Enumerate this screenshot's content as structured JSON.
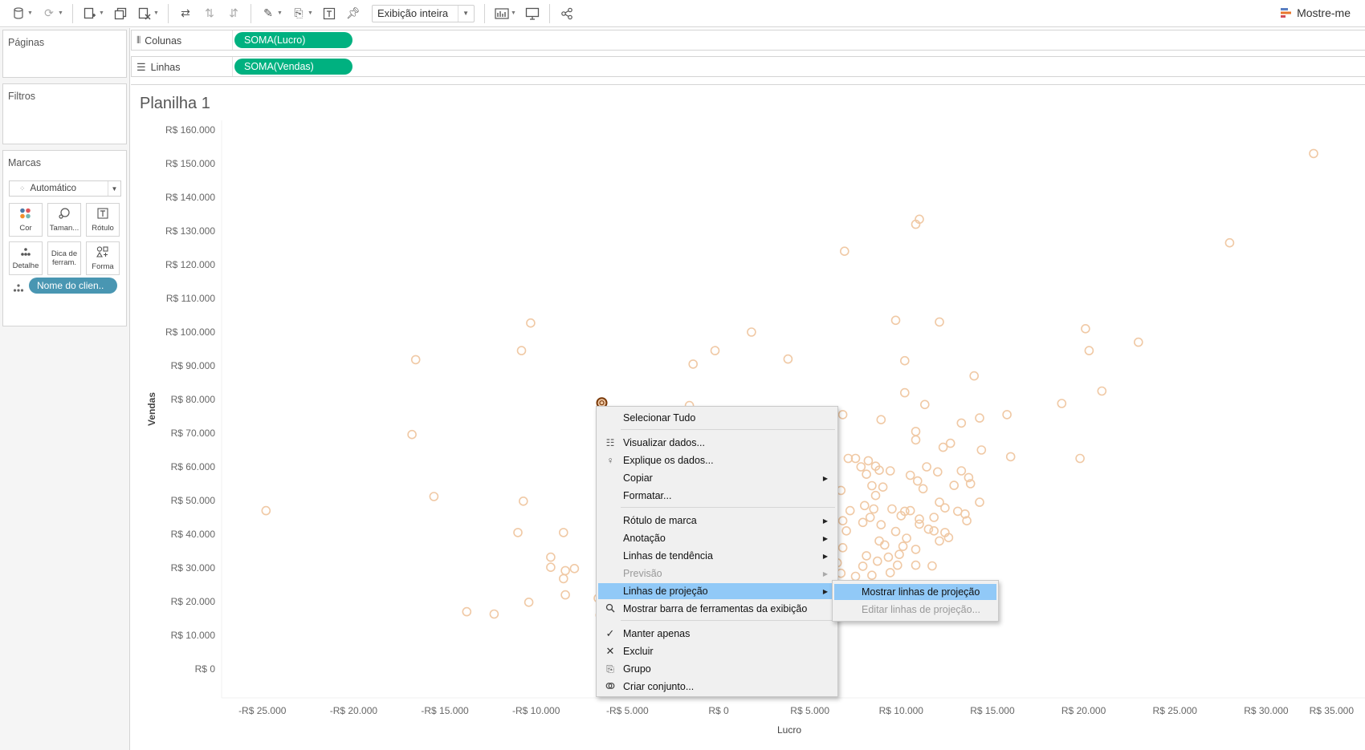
{
  "toolbar": {
    "view_select": "Exibição inteira",
    "show_me": "Mostre-me"
  },
  "panels": {
    "pages": "Páginas",
    "filters": "Filtros",
    "marks": "Marcas",
    "mark_type": "Automático",
    "mark_buttons": [
      "Cor",
      "Taman...",
      "Rótulo",
      "Detalhe",
      "Dica de\nferram.",
      "Forma"
    ],
    "detail_pill": "Nome do clien.."
  },
  "shelves": {
    "columns_label": "Colunas",
    "columns_pill": "SOMA(Lucro)",
    "rows_label": "Linhas",
    "rows_pill": "SOMA(Vendas)"
  },
  "sheet": {
    "title": "Planilha 1"
  },
  "chart_data": {
    "type": "scatter",
    "xlabel": "Lucro",
    "ylabel": "Vendas",
    "xlim": [
      -27000,
      35000
    ],
    "ylim": [
      -8000,
      163000
    ],
    "x_ticks": [
      -25000,
      -20000,
      -15000,
      -10000,
      -5000,
      0,
      5000,
      10000,
      15000,
      20000,
      25000,
      30000,
      35000
    ],
    "x_tick_labels": [
      "-R$ 25.000",
      "-R$ 20.000",
      "-R$ 15.000",
      "-R$ 10.000",
      "-R$ 5.000",
      "R$ 0",
      "R$ 5.000",
      "R$ 10.000",
      "R$ 15.000",
      "R$ 20.000",
      "R$ 25.000",
      "R$ 30.000",
      "R$ 35.000"
    ],
    "y_ticks": [
      0,
      10000,
      20000,
      30000,
      40000,
      50000,
      60000,
      70000,
      80000,
      90000,
      100000,
      110000,
      120000,
      130000,
      140000,
      150000,
      160000
    ],
    "y_tick_labels": [
      "R$ 0",
      "R$ 10.000",
      "R$ 20.000",
      "R$ 30.000",
      "R$ 40.000",
      "R$ 50.000",
      "R$ 60.000",
      "R$ 70.000",
      "R$ 80.000",
      "R$ 90.000",
      "R$ 100.000",
      "R$ 110.000",
      "R$ 120.000",
      "R$ 130.000",
      "R$ 140.000",
      "R$ 150.000",
      "R$ 160.000"
    ],
    "grid": false,
    "marker_color": "#f0c9a5",
    "selected_color": "#7a3a0a",
    "selected_point": [
      -6400,
      79000
    ],
    "points": [
      [
        32600,
        153000
      ],
      [
        28000,
        126500
      ],
      [
        11000,
        133500
      ],
      [
        10800,
        132000
      ],
      [
        6900,
        124000
      ],
      [
        9700,
        103500
      ],
      [
        12100,
        103000
      ],
      [
        20100,
        101000
      ],
      [
        23000,
        97000
      ],
      [
        20300,
        94500
      ],
      [
        -10300,
        102700
      ],
      [
        1800,
        100000
      ],
      [
        -200,
        94500
      ],
      [
        -1400,
        90500
      ],
      [
        3800,
        92000
      ],
      [
        -16600,
        91800
      ],
      [
        -10800,
        94500
      ],
      [
        10200,
        91500
      ],
      [
        14000,
        87000
      ],
      [
        21000,
        82500
      ],
      [
        18800,
        78800
      ],
      [
        10200,
        82000
      ],
      [
        11300,
        78500
      ],
      [
        6800,
        75500
      ],
      [
        8900,
        74000
      ],
      [
        13300,
        73000
      ],
      [
        14300,
        74500
      ],
      [
        15800,
        75500
      ],
      [
        10800,
        70500
      ],
      [
        10800,
        68000
      ],
      [
        12300,
        65800
      ],
      [
        12700,
        67000
      ],
      [
        14400,
        65000
      ],
      [
        16000,
        63000
      ],
      [
        19800,
        62500
      ],
      [
        -16800,
        69600
      ],
      [
        -15600,
        51200
      ],
      [
        -24800,
        47000
      ],
      [
        -10700,
        49800
      ],
      [
        -11000,
        40500
      ],
      [
        -8500,
        40500
      ],
      [
        -9200,
        33200
      ],
      [
        -9200,
        30200
      ],
      [
        -8400,
        29200
      ],
      [
        -7900,
        29800
      ],
      [
        -8500,
        26800
      ],
      [
        -8400,
        22000
      ],
      [
        -10400,
        19800
      ],
      [
        -12300,
        16300
      ],
      [
        -13800,
        17000
      ],
      [
        -6500,
        16000
      ],
      [
        -6600,
        21000
      ],
      [
        -6300,
        22500
      ],
      [
        -6400,
        44500
      ],
      [
        -1600,
        78200
      ],
      [
        10500,
        57500
      ],
      [
        11400,
        60000
      ],
      [
        12000,
        58500
      ],
      [
        13300,
        58800
      ],
      [
        13700,
        56800
      ],
      [
        13800,
        55000
      ],
      [
        12900,
        54500
      ],
      [
        10900,
        55800
      ],
      [
        11200,
        53500
      ],
      [
        12100,
        49500
      ],
      [
        12400,
        47800
      ],
      [
        13100,
        46800
      ],
      [
        13500,
        46000
      ],
      [
        14300,
        49500
      ],
      [
        13600,
        44000
      ],
      [
        11800,
        45000
      ],
      [
        11000,
        43000
      ],
      [
        10200,
        46800
      ],
      [
        9500,
        47500
      ],
      [
        9700,
        40800
      ],
      [
        10300,
        38800
      ],
      [
        11800,
        41000
      ],
      [
        12400,
        40500
      ],
      [
        12100,
        38000
      ],
      [
        10100,
        36400
      ],
      [
        9100,
        36800
      ],
      [
        9300,
        33200
      ],
      [
        10800,
        30800
      ],
      [
        11700,
        30600
      ],
      [
        9400,
        28600
      ],
      [
        8100,
        33600
      ],
      [
        7900,
        30500
      ],
      [
        7500,
        27500
      ],
      [
        6700,
        28400
      ],
      [
        7400,
        24000
      ],
      [
        6900,
        22800
      ],
      [
        6800,
        36000
      ],
      [
        7000,
        41000
      ],
      [
        6800,
        44000
      ],
      [
        7200,
        47000
      ],
      [
        8000,
        48500
      ],
      [
        8600,
        51500
      ],
      [
        8400,
        54400
      ],
      [
        8100,
        57800
      ],
      [
        8800,
        59000
      ],
      [
        9400,
        58800
      ],
      [
        9000,
        54000
      ],
      [
        8300,
        45000
      ],
      [
        8900,
        42800
      ],
      [
        8800,
        38000
      ],
      [
        8700,
        32000
      ],
      [
        8400,
        27800
      ],
      [
        7800,
        25000
      ],
      [
        7100,
        62500
      ],
      [
        7500,
        62500
      ],
      [
        7800,
        60000
      ],
      [
        8200,
        61800
      ],
      [
        8600,
        60200
      ],
      [
        6700,
        53000
      ],
      [
        10000,
        45500
      ],
      [
        10500,
        47000
      ],
      [
        11000,
        44500
      ],
      [
        11500,
        41500
      ],
      [
        12600,
        39000
      ],
      [
        9800,
        30800
      ],
      [
        8500,
        47500
      ],
      [
        7900,
        43500
      ],
      [
        6500,
        31500
      ],
      [
        9900,
        34000
      ],
      [
        10800,
        35500
      ]
    ]
  },
  "context_menu": {
    "items": [
      "Selecionar Tudo",
      "Visualizar dados...",
      "Explique os dados...",
      "Copiar",
      "Formatar...",
      "Rótulo de marca",
      "Anotação",
      "Linhas de tendência",
      "Previsão",
      "Linhas de projeção",
      "Mostrar barra de ferramentas da exibição",
      "Manter apenas",
      "Excluir",
      "Grupo",
      "Criar conjunto..."
    ]
  },
  "submenu": {
    "items": [
      "Mostrar linhas de projeção",
      "Editar linhas de projeção..."
    ]
  }
}
